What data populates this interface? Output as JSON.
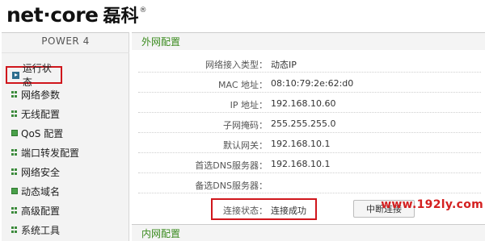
{
  "header": {
    "logo_text": "net·core",
    "logo_cn": "磊科",
    "logo_reg": "®"
  },
  "sidebar": {
    "title": "POWER 4",
    "items": [
      {
        "label": "运行状态",
        "icon": "play-icon",
        "selected": true
      },
      {
        "label": "网络参数",
        "icon": "grid-icon"
      },
      {
        "label": "无线配置",
        "icon": "grid-icon"
      },
      {
        "label": "QoS 配置",
        "icon": "square-icon"
      },
      {
        "label": "端口转发配置",
        "icon": "grid-icon"
      },
      {
        "label": "网络安全",
        "icon": "grid-icon"
      },
      {
        "label": "动态域名",
        "icon": "square-icon"
      },
      {
        "label": "高级配置",
        "icon": "grid-icon"
      },
      {
        "label": "系统工具",
        "icon": "grid-icon"
      }
    ]
  },
  "wan": {
    "section_title": "外网配置",
    "rows": [
      {
        "label": "网络接入类型：",
        "value": "动态IP"
      },
      {
        "label": "MAC 地址：",
        "value": "08:10:79:2e:62:d0"
      },
      {
        "label": "IP 地址：",
        "value": "192.168.10.60"
      },
      {
        "label": "子网掩码：",
        "value": "255.255.255.0"
      },
      {
        "label": "默认网关：",
        "value": "192.168.10.1"
      },
      {
        "label": "首选DNS服务器：",
        "value": "192.168.10.1"
      },
      {
        "label": "备选DNS服务器：",
        "value": ""
      },
      {
        "label": "连接状态：",
        "value": "连接成功"
      }
    ],
    "disconnect_label": "中断连接"
  },
  "lan": {
    "section_title": "内网配置"
  },
  "watermark": "www.192ly.com",
  "colors": {
    "section_title": "#3a8a1e",
    "highlight_box": "#d0161c",
    "watermark": "#d42020"
  }
}
